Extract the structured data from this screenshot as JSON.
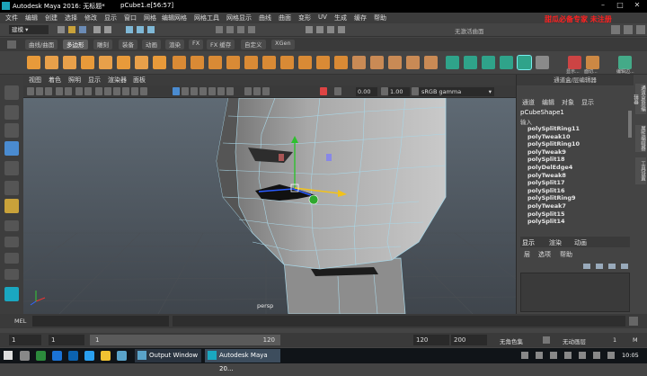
{
  "window": {
    "title": "Autodesk Maya 2016: 无标题*",
    "file": "pCube1.e[56:57]"
  },
  "watermark": "甜瓜必备专家 未注册",
  "menubar": [
    "文件",
    "编辑",
    "创建",
    "选择",
    "修改",
    "显示",
    "窗口",
    "网格",
    "编辑网格",
    "网格工具",
    "网格显示",
    "曲线",
    "曲面",
    "变形",
    "UV",
    "生成",
    "缓存",
    "帮助"
  ],
  "statusline": {
    "mode": "建模",
    "no_live": "无激活曲面"
  },
  "shelf_tabs": [
    "曲线/曲面",
    "多边形",
    "雕刻",
    "装备",
    "动画",
    "渲染",
    "FX",
    "FX 缓存",
    "自定义",
    "XGen"
  ],
  "shelf_labels": [
    "显示...",
    "面切... ",
    "编辑边..."
  ],
  "viewport_menu": [
    "视图",
    "着色",
    "照明",
    "显示",
    "渲染器",
    "面板"
  ],
  "viewport_toolbar": {
    "val1": "0.00",
    "val2": "1.00",
    "colorspace": "sRGB gamma"
  },
  "viewport_label": "persp",
  "channel_box": {
    "header": "通道盒/层编辑器",
    "tabs": [
      "通道",
      "编辑",
      "对象",
      "显示"
    ],
    "object": "pCubeShape1",
    "input_label": "输入",
    "history": [
      "polySplitRing11",
      "polyTweak10",
      "polySplitRing10",
      "polyTweak9",
      "polySplit18",
      "polyDelEdge4",
      "polyTweak8",
      "polySplit17",
      "polySplit16",
      "polySplitRing9",
      "polyTweak7",
      "polySplit15",
      "polySplit14"
    ]
  },
  "layer_editor": {
    "tabs": [
      "显示",
      "渲染",
      "动画"
    ],
    "menu": [
      "层",
      "选项",
      "帮助"
    ]
  },
  "side_tabs": [
    "通道盒/层编辑器",
    "属性编辑器",
    "工具设置"
  ],
  "cmdline": {
    "label": "MEL"
  },
  "timeline": {
    "start": "1",
    "current": "1",
    "range_marker": "1",
    "range_end_label": "120",
    "end": "120",
    "end2": "200",
    "char_set": "无角色集",
    "anim_layer": "无动画层",
    "frame": "1",
    "auto_label": "M"
  },
  "taskbar": {
    "apps": [
      {
        "label": "Output Window"
      },
      {
        "label": "Autodesk Maya 20..."
      }
    ],
    "clock": "10:05"
  }
}
